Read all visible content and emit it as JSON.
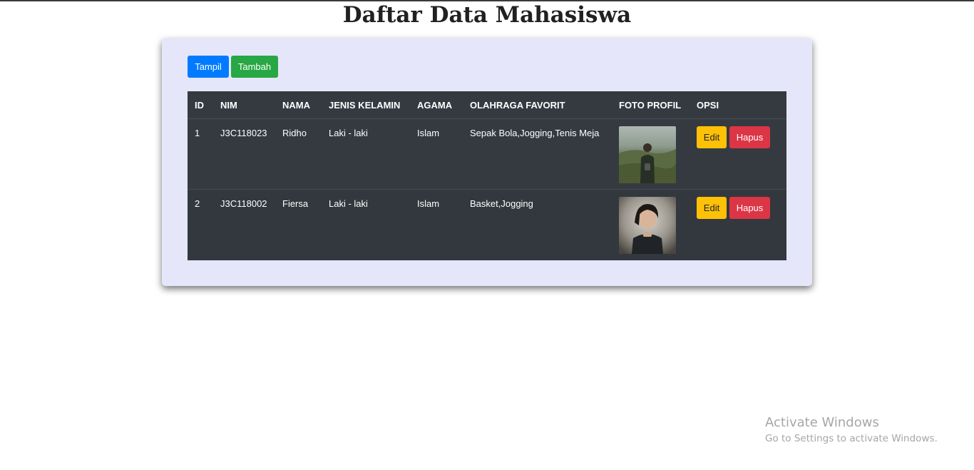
{
  "page": {
    "title": "Daftar Data Mahasiswa"
  },
  "toolbar": {
    "tampil_label": "Tampil",
    "tambah_label": "Tambah"
  },
  "table": {
    "headers": [
      "ID",
      "NIM",
      "NAMA",
      "JENIS KELAMIN",
      "AGAMA",
      "OLAHRAGA FAVORIT",
      "FOTO PROFIL",
      "OPSI"
    ],
    "rows": [
      {
        "id": "1",
        "nim": "J3C118023",
        "nama": "Ridho",
        "jenis_kelamin": "Laki - laki",
        "agama": "Islam",
        "olahraga": "Sepak Bola,Jogging,Tenis Meja",
        "edit_label": "Edit",
        "hapus_label": "Hapus"
      },
      {
        "id": "2",
        "nim": "J3C118002",
        "nama": "Fiersa",
        "jenis_kelamin": "Laki - laki",
        "agama": "Islam",
        "olahraga": "Basket,Jogging",
        "edit_label": "Edit",
        "hapus_label": "Hapus"
      }
    ]
  },
  "watermark": {
    "title": "Activate Windows",
    "subtitle": "Go to Settings to activate Windows."
  },
  "colors": {
    "panel_bg": "#e6e6fa",
    "table_bg": "#343a40",
    "primary": "#007bff",
    "success": "#28a745",
    "warning": "#ffc107",
    "danger": "#dc3545"
  }
}
